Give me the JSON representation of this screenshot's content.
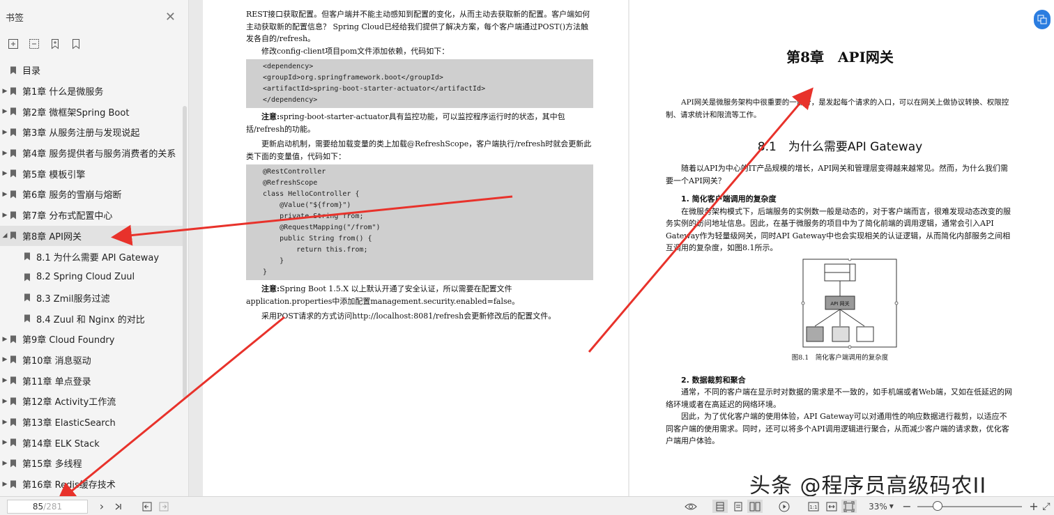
{
  "sidebar": {
    "title": "书签",
    "items": [
      {
        "label": "目录",
        "arrow": "",
        "child": false,
        "active": false
      },
      {
        "label": "第1章 什么是微服务",
        "arrow": "▶",
        "child": false,
        "active": false
      },
      {
        "label": "第2章 微框架Spring Boot",
        "arrow": "▶",
        "child": false,
        "active": false
      },
      {
        "label": "第3章 从服务注册与发现说起",
        "arrow": "▶",
        "child": false,
        "active": false
      },
      {
        "label": "第4章 服务提供者与服务消费者的关系",
        "arrow": "▶",
        "child": false,
        "active": false
      },
      {
        "label": "第5章 模板引擎",
        "arrow": "▶",
        "child": false,
        "active": false
      },
      {
        "label": "第6章 服务的雪崩与熔断",
        "arrow": "▶",
        "child": false,
        "active": false
      },
      {
        "label": "第7章 分布式配置中心",
        "arrow": "▶",
        "child": false,
        "active": false
      },
      {
        "label": "第8章 API网关",
        "arrow": "◢",
        "child": false,
        "active": true
      },
      {
        "label": "8.1 为什么需要 API Gateway",
        "arrow": "",
        "child": true,
        "active": false
      },
      {
        "label": "8.2 Spring Cloud Zuul",
        "arrow": "",
        "child": true,
        "active": false
      },
      {
        "label": "8.3 Zmil服务过滤",
        "arrow": "",
        "child": true,
        "active": false
      },
      {
        "label": "8.4 Zuul 和 Nginx 的对比",
        "arrow": "",
        "child": true,
        "active": false
      },
      {
        "label": "第9章 Cloud Foundry",
        "arrow": "▶",
        "child": false,
        "active": false
      },
      {
        "label": "第10章 消息驱动",
        "arrow": "▶",
        "child": false,
        "active": false
      },
      {
        "label": "第11章 单点登录",
        "arrow": "▶",
        "child": false,
        "active": false
      },
      {
        "label": "第12章 Activity工作流",
        "arrow": "▶",
        "child": false,
        "active": false
      },
      {
        "label": "第13章 ElasticSearch",
        "arrow": "▶",
        "child": false,
        "active": false
      },
      {
        "label": "第14章 ELK Stack",
        "arrow": "▶",
        "child": false,
        "active": false
      },
      {
        "label": "第15章 多线程",
        "arrow": "▶",
        "child": false,
        "active": false
      },
      {
        "label": "第16章 Redis缓存技术",
        "arrow": "▶",
        "child": false,
        "active": false
      }
    ]
  },
  "left_page": {
    "p1": "REST接口获取配置。但客户端并不能主动感知到配置的变化，从而主动去获取新的配置。客户端如何主动获取新的配置信息？ Spring Cloud已经给我们提供了解决方案，每个客户端通过POST()方法触发各自的/refresh。",
    "p2": "修改config-client项目pom文件添加依赖，代码如下：",
    "code1": [
      "<dependency>",
      "<groupId>org.springframework.boot</groupId>",
      "<artifactId>spring-boot-starter-actuator</artifactId>",
      "</dependency>"
    ],
    "note1_label": "注意:",
    "note1": "spring-boot-starter-actuator具有监控功能，可以监控程序运行时的状态，其中包括/refresh的功能。",
    "p3": "更新启动机制，需要给加载变量的类上加载@RefreshScope，客户端执行/refresh时就会更新此类下面的变量值，代码如下：",
    "code2": [
      "@RestController",
      "@RefreshScope",
      "class HelloController {",
      "    @Value(\"${from}\")",
      "    private String from;",
      "    @RequestMapping(\"/from\")",
      "    public String from() {",
      "        return this.from;",
      "    }",
      "}"
    ],
    "note2_label": "注意:",
    "note2": "Spring Boot 1.5.X 以上默认开通了安全认证，所以需要在配置文件application.properties中添加配置management.security.enabled=false。",
    "p4": "采用POST请求的方式访问http://localhost:8081/refresh会更新修改后的配置文件。"
  },
  "right_page": {
    "chapter_title": "第8章　API网关",
    "intro": "API网关是微服务架构中很重要的一部分，是发起每个请求的入口，可以在网关上做协议转换、权限控制、请求统计和限流等工作。",
    "section_title": "8.1　为什么需要API Gateway",
    "p1": "随着以API为中心的IT产品规模的增长，API网关和管理层变得越来越常见。然而，为什么我们需要一个API网关？",
    "h1": "1. 简化客户端调用的复杂度",
    "p2": "在微服务架构模式下，后端服务的实例数一般是动态的，对于客户端而言，很难发现动态改变的服务实例的访问地址信息。因此，在基于微服务的项目中为了简化前端的调用逻辑，通常会引入API Gateway作为轻量级网关，同时API Gateway中也会实现相关的认证逻辑，从而简化内部服务之间相互调用的复杂度，如图8.1所示。",
    "figure_box_label": "API 网关",
    "figure_caption": "图8.1　简化客户端调用的复杂度",
    "h2": "2. 数据裁剪和聚合",
    "p3": "通常，不同的客户端在显示时对数据的需求是不一致的，如手机端或者Web端，又如在低延迟的网络环境或者在高延迟的网络环境。",
    "p4": "因此，为了优化客户端的使用体验，API Gateway可以对通用性的响应数据进行裁剪，以适应不同客户端的使用需求。同时，还可以将多个API调用逻辑进行聚合，从而减少客户端的请求数，优化客户端用户体验。"
  },
  "toolbar": {
    "page_current": "85",
    "page_total": "/281",
    "zoom": "33%",
    "zoom_minus": "−",
    "zoom_plus": "+",
    "fullscreen": "⤢"
  },
  "watermark": "头条 @程序员高级码农II",
  "colors": {
    "arrow": "#e8322b",
    "accent": "#2b7de0"
  }
}
